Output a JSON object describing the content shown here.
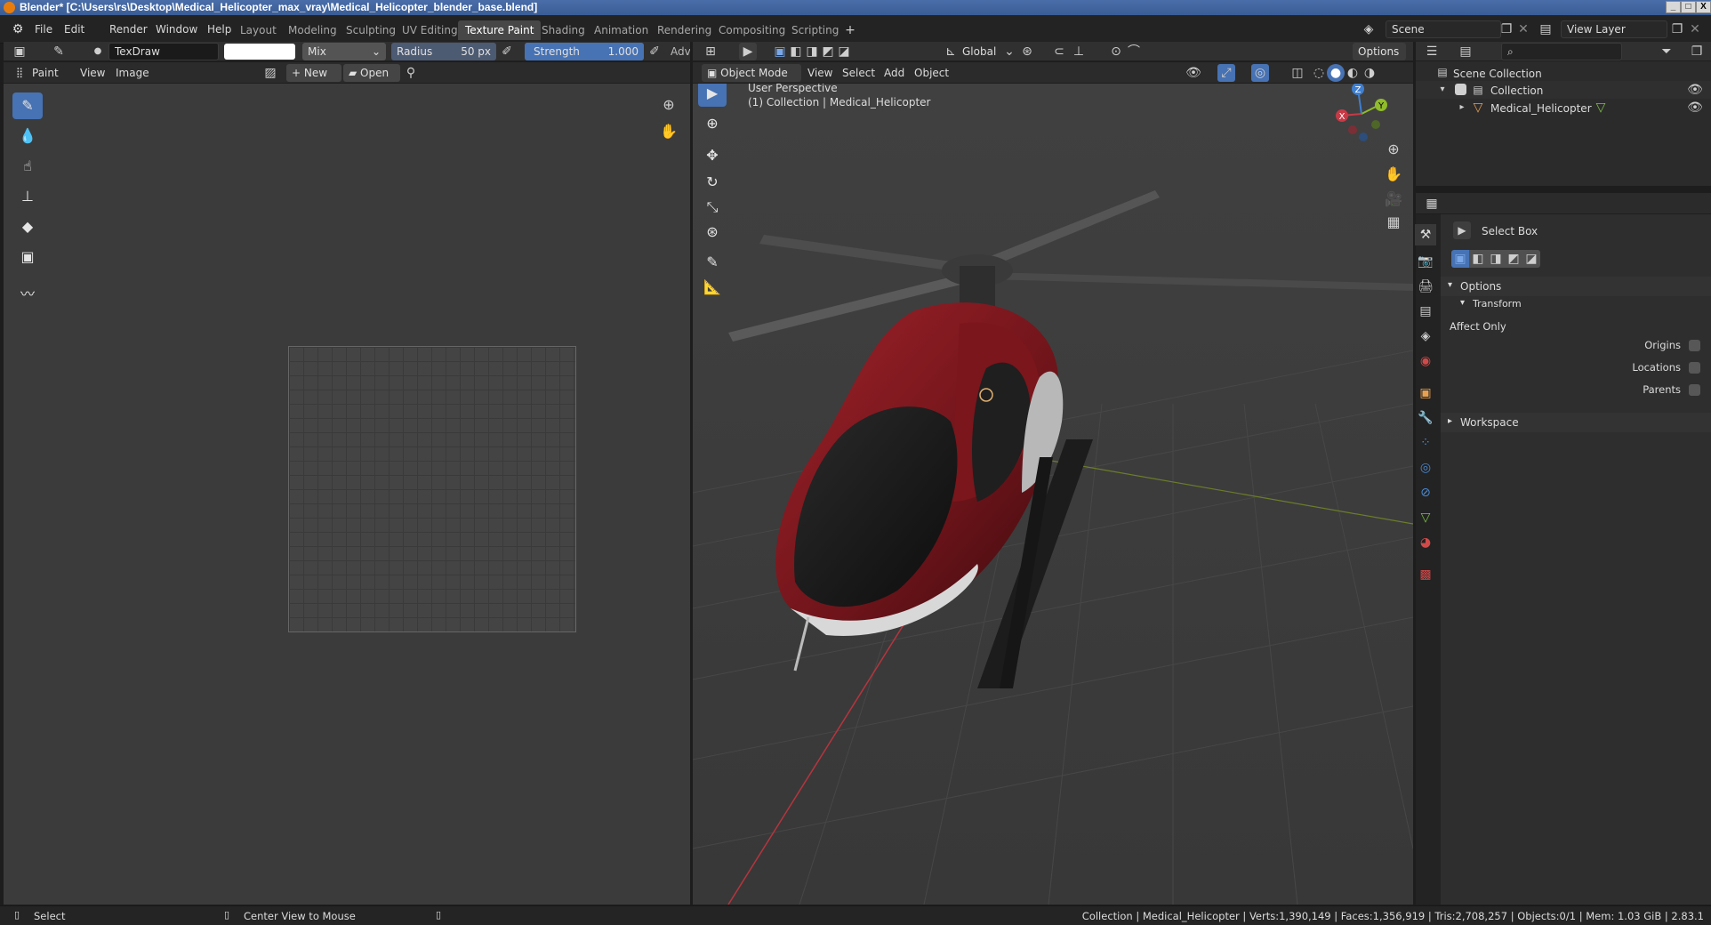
{
  "window": {
    "title": "Blender* [C:\\Users\\rs\\Desktop\\Medical_Helicopter_max_vray\\Medical_Helicopter_blender_base.blend]",
    "minimize": "_",
    "maximize": "□",
    "close": "X"
  },
  "menu": [
    "File",
    "Edit",
    "Render",
    "Window",
    "Help"
  ],
  "workspaces": [
    "Layout",
    "Modeling",
    "Sculpting",
    "UV Editing",
    "Texture Paint",
    "Shading",
    "Animation",
    "Rendering",
    "Compositing",
    "Scripting"
  ],
  "active_workspace": "Texture Paint",
  "scene": {
    "name": "Scene",
    "view_layer": "View Layer"
  },
  "image_editor": {
    "brush_name": "TexDraw",
    "blend_mode": "Mix",
    "radius_label": "Radius",
    "radius_value": "50 px",
    "strength_label": "Strength",
    "strength_value": "1.000",
    "strength_fraction": 1.0,
    "advanced_label": "Adv",
    "mode_label": "Paint",
    "view_menu": "View",
    "image_menu": "Image",
    "new_label": "New",
    "open_label": "Open",
    "brush_color": "#ffffff"
  },
  "viewport": {
    "transform_orientation": "Global",
    "options_label": "Options",
    "object_mode": "Object Mode",
    "menus": [
      "View",
      "Select",
      "Add",
      "Object"
    ],
    "overlay_line1": "User Perspective",
    "overlay_line2": "(1) Collection | Medical_Helicopter",
    "gizmo_axes": [
      "X",
      "Y",
      "Z"
    ]
  },
  "outliner": {
    "root": "Scene Collection",
    "collection": "Collection",
    "object": "Medical_Helicopter"
  },
  "properties": {
    "tool_name": "Select Box",
    "options_header": "Options",
    "transform_header": "Transform",
    "affect_only": "Affect Only",
    "options": [
      "Origins",
      "Locations",
      "Parents"
    ],
    "workspace_header": "Workspace"
  },
  "statusbar": {
    "left_hint": "Select",
    "middle_hint": "Center View to Mouse",
    "stats": "Collection | Medical_Helicopter | Verts:1,390,149 | Faces:1,356,919 | Tris:2,708,257 | Objects:0/1 | Mem: 1.03 GiB | 2.83.1"
  },
  "colors": {
    "accent": "#4772b3",
    "helicopter_red": "#8a1a1f",
    "x_axis": "#c63a46",
    "y_axis": "#8fbc2a",
    "z_axis": "#3f7fd0"
  }
}
